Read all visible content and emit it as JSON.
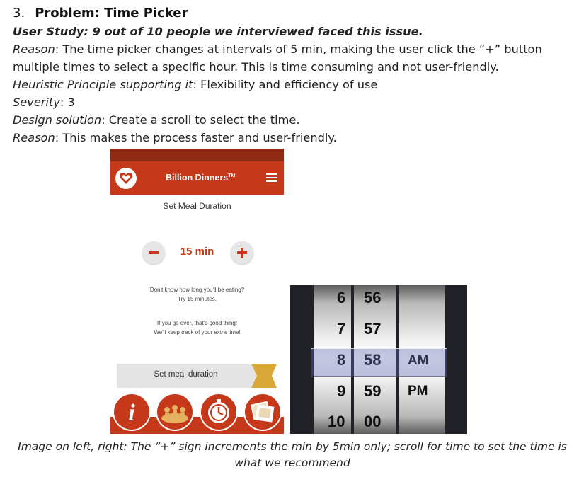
{
  "doc": {
    "number": "3.",
    "title": "Problem: Time Picker",
    "user_study": "User Study: 9 out of 10 people we interviewed faced this issue.",
    "reason1_label": "Reason",
    "reason1_line1": ": The time picker changes at intervals of 5 min, making the user click the “+” button",
    "reason1_line2": "multiple times to select a specific hour. This is time consuming and not user-friendly.",
    "heuristic_label": "Heuristic Principle supporting it",
    "heuristic_text": ": Flexibility and efficiency of use",
    "severity_label": "Severity",
    "severity_text": ": 3",
    "design_label": "Design solution",
    "design_text": ": Create a scroll to select the time.",
    "reason2_label": "Reason",
    "reason2_text": ": This makes the process faster and user-friendly.",
    "caption": "Image on left, right: The “+” sign increments the min by 5min only; scroll for time to set the time is what we recommend"
  },
  "phone": {
    "app_name": "Billion Dinners",
    "tm": "TM",
    "subtitle": "Set Meal Duration",
    "duration": "15 min",
    "hint1_line1": "Don't know how long you'll be eating?",
    "hint1_line2": "Try 15 minutes.",
    "hint2_line1": "If you go over, that's good thing!",
    "hint2_line2": "We'll keep track of your extra time!",
    "button_label": "Set meal duration",
    "icon_info_glyph": "i",
    "colors": {
      "brand": "#c5391a",
      "brand_dark": "#8f2a14",
      "accent": "#d9a83a"
    }
  },
  "picker": {
    "hours": [
      "6",
      "7",
      "8",
      "9",
      "10"
    ],
    "minutes": [
      "56",
      "57",
      "58",
      "59",
      "00"
    ],
    "periods": [
      "AM",
      "PM"
    ],
    "selected": {
      "hour": "8",
      "minute": "58",
      "period": "AM"
    }
  }
}
